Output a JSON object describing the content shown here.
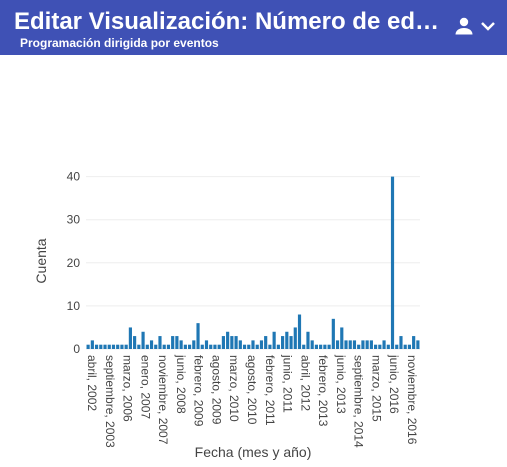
{
  "header": {
    "title": "Editar Visualización: Número de edicione…",
    "subtitle": "Programación dirigida por eventos",
    "user_icon": "person-icon",
    "menu_icon": "chevron-down-icon"
  },
  "colors": {
    "header_bg": "#3f51b5",
    "bar": "#1f77b4",
    "grid": "#eeeeee"
  },
  "chart_data": {
    "type": "bar",
    "xlabel": "Fecha (mes y año)",
    "ylabel": "Cuenta",
    "ylim": [
      0,
      42
    ],
    "yticks": [
      0,
      10,
      20,
      30,
      40
    ],
    "grid": true,
    "x_tick_labels": [
      "abril, 2002",
      "septiembre, 2003",
      "marzo, 2006",
      "enero, 2007",
      "noviembre, 2007",
      "junio, 2008",
      "febrero, 2009",
      "agosto, 2009",
      "marzo, 2010",
      "agosto, 2010",
      "febrero, 2011",
      "junio, 2011",
      "abril, 2012",
      "febrero, 2013",
      "junio, 2013",
      "septiembre, 2014",
      "marzo, 2015",
      "junio, 2016",
      "noviembre, 2016"
    ],
    "values": [
      1,
      2,
      1,
      1,
      1,
      1,
      1,
      1,
      1,
      1,
      5,
      3,
      1,
      4,
      1,
      2,
      1,
      3,
      1,
      1,
      3,
      3,
      2,
      1,
      1,
      2,
      6,
      1,
      2,
      1,
      1,
      1,
      3,
      4,
      3,
      3,
      2,
      1,
      1,
      2,
      1,
      2,
      3,
      1,
      4,
      1,
      3,
      4,
      3,
      5,
      8,
      1,
      4,
      2,
      1,
      1,
      1,
      1,
      7,
      2,
      5,
      2,
      2,
      2,
      1,
      2,
      2,
      2,
      1,
      1,
      2,
      1,
      40,
      1,
      3,
      1,
      1,
      3,
      2
    ]
  }
}
